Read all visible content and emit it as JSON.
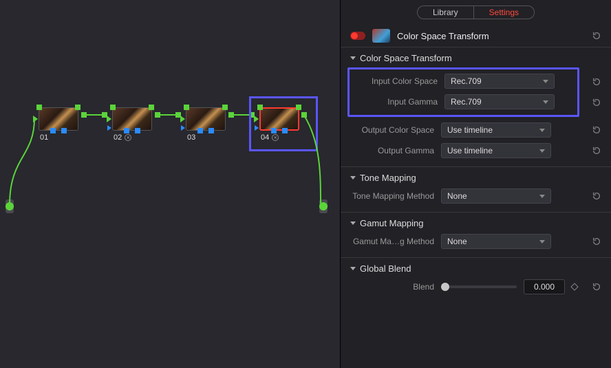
{
  "tabs": {
    "library": "Library",
    "settings": "Settings",
    "active": "settings"
  },
  "plugin": {
    "name": "Color Space Transform"
  },
  "sections": {
    "cst": {
      "title": "Color Space Transform",
      "input_cs_label": "Input Color Space",
      "input_cs_value": "Rec.709",
      "input_gamma_label": "Input Gamma",
      "input_gamma_value": "Rec.709",
      "output_cs_label": "Output Color Space",
      "output_cs_value": "Use timeline",
      "output_gamma_label": "Output Gamma",
      "output_gamma_value": "Use timeline"
    },
    "tone": {
      "title": "Tone Mapping",
      "method_label": "Tone Mapping Method",
      "method_value": "None"
    },
    "gamut": {
      "title": "Gamut Mapping",
      "method_label": "Gamut Ma…g Method",
      "method_value": "None"
    },
    "blend": {
      "title": "Global Blend",
      "label": "Blend",
      "value": "0.000"
    }
  },
  "nodes": {
    "n1": "01",
    "n2": "02",
    "n3": "03",
    "n4": "04"
  }
}
